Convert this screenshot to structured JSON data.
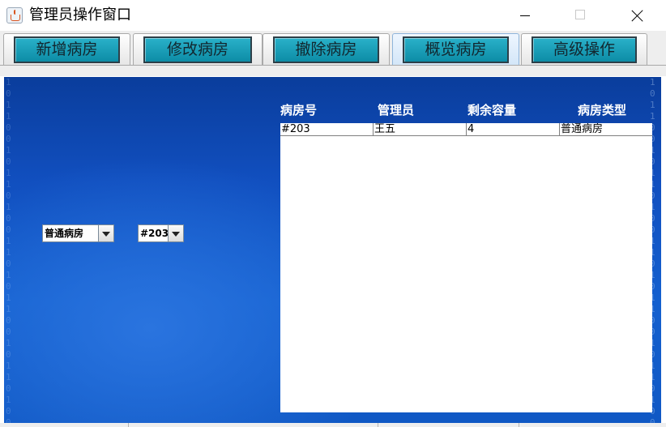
{
  "window": {
    "title": "管理员操作窗口"
  },
  "tabs": [
    {
      "label": "新增病房",
      "selected": false
    },
    {
      "label": "修改病房",
      "selected": false
    },
    {
      "label": "撤除病房",
      "selected": false
    },
    {
      "label": "概览病房",
      "selected": true
    },
    {
      "label": "高级操作",
      "selected": false
    }
  ],
  "filters": {
    "room_type": {
      "value": "普通病房"
    },
    "room_number": {
      "value": "#203"
    }
  },
  "table": {
    "columns": [
      "病房号",
      "管理员",
      "剩余容量",
      "病房类型"
    ],
    "rows": [
      [
        "#203",
        "王五",
        "4",
        "普通病房"
      ]
    ]
  },
  "colors": {
    "tab_button": "#1aa0b8",
    "content_background": "#1460cf",
    "table_background": "#ffffff"
  }
}
